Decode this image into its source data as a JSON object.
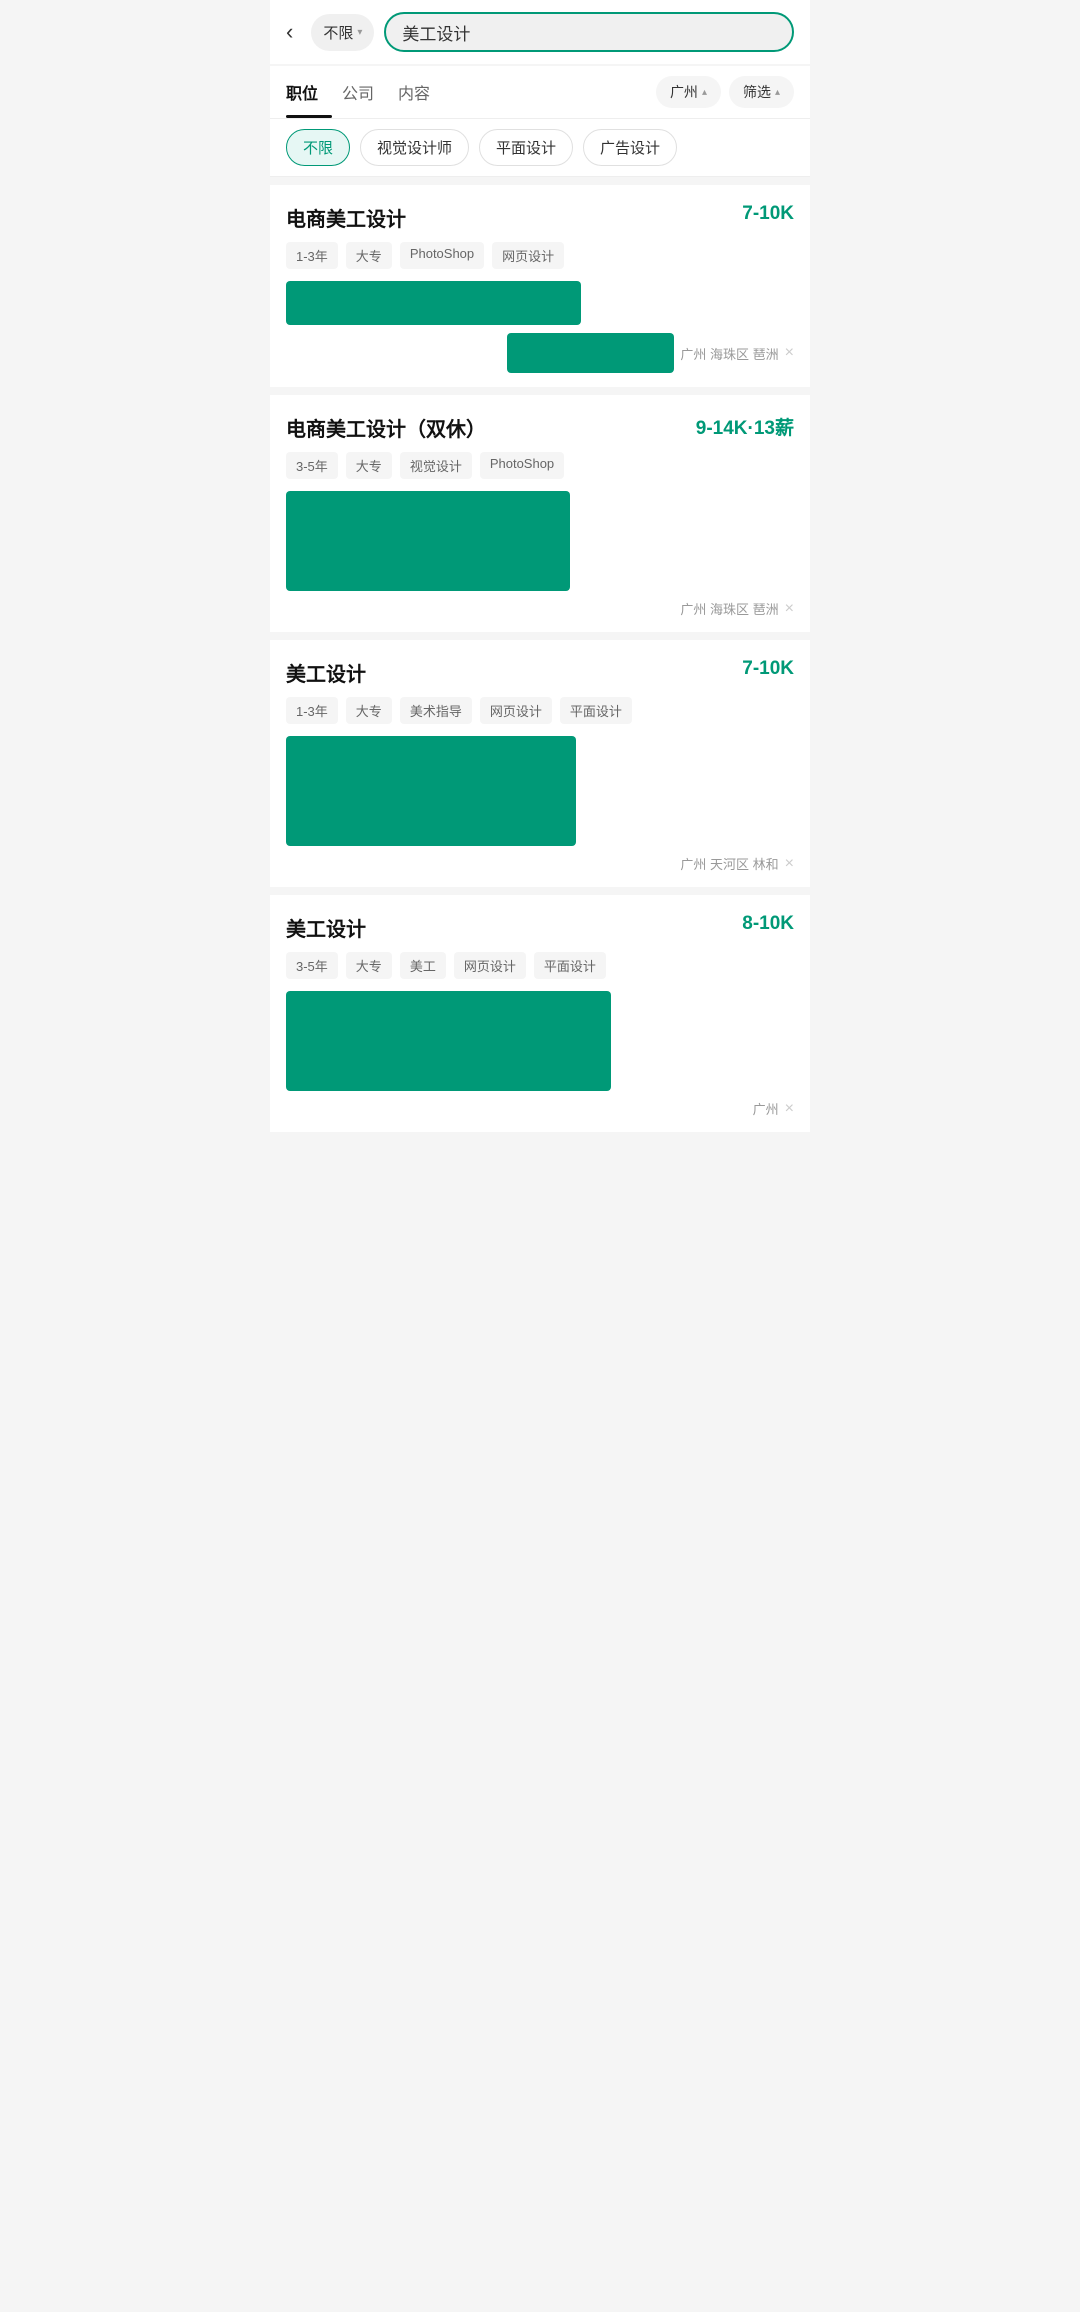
{
  "header": {
    "back_label": "‹",
    "location": "不限",
    "location_arrow": "▾",
    "search_placeholder": "美工设计",
    "search_value": "美工设计"
  },
  "tabs": {
    "items": [
      {
        "id": "position",
        "label": "职位",
        "active": true
      },
      {
        "id": "company",
        "label": "公司",
        "active": false
      },
      {
        "id": "content",
        "label": "内容",
        "active": false
      }
    ],
    "city_filter": "广州",
    "city_arrow": "▴",
    "screen_filter": "筛选",
    "screen_arrow": "▴"
  },
  "categories": [
    {
      "id": "all",
      "label": "不限",
      "active": true
    },
    {
      "id": "visual",
      "label": "视觉设计师",
      "active": false
    },
    {
      "id": "graphic",
      "label": "平面设计",
      "active": false
    },
    {
      "id": "ad",
      "label": "广告设计",
      "active": false
    }
  ],
  "jobs": [
    {
      "id": "job1",
      "title": "电商美工设计",
      "salary": "7-10K",
      "tags": [
        "1-3年",
        "大专",
        "PhotoShop",
        "网页设计"
      ],
      "location": "广州 海珠区 琶洲",
      "company_bar_size": "large",
      "company_bar_size2": "medium"
    },
    {
      "id": "job2",
      "title": "电商美工设计（双休）",
      "salary": "9-14K·13薪",
      "tags": [
        "3-5年",
        "大专",
        "视觉设计",
        "PhotoShop"
      ],
      "location": "广州 海珠区 琶洲",
      "company_bar_size": "xlarge"
    },
    {
      "id": "job3",
      "title": "美工设计",
      "salary": "7-10K",
      "tags": [
        "1-3年",
        "大专",
        "美术指导",
        "网页设计",
        "平面设计"
      ],
      "location": "广州 天河区 林和",
      "company_bar_size": "xlarge2"
    },
    {
      "id": "job4",
      "title": "美工设计",
      "salary": "8-10K",
      "tags": [
        "3-5年",
        "大专",
        "美工",
        "网页设计",
        "平面设计"
      ],
      "location": "广州",
      "company_bar_size": "xlarge3"
    }
  ],
  "icons": {
    "close": "×",
    "back": "‹"
  }
}
